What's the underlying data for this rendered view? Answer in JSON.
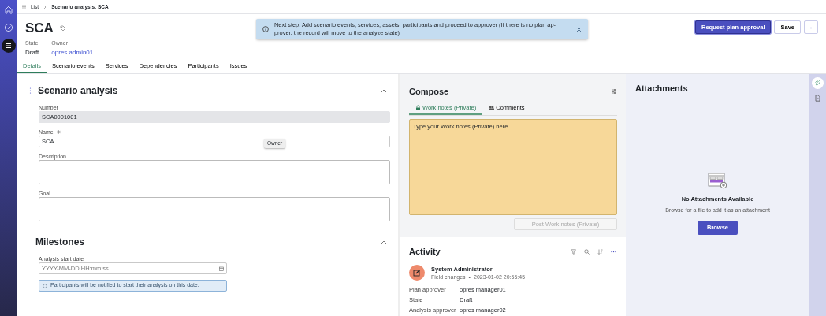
{
  "nav_rail": {
    "items": [
      {
        "kind": "home",
        "selected": false
      },
      {
        "kind": "check",
        "selected": false
      },
      {
        "kind": "list",
        "selected": true
      }
    ]
  },
  "breadcrumb": [
    "List",
    "Scenario analysis: SCA"
  ],
  "record": {
    "title": "SCA",
    "state_label": "State",
    "state": "Draft",
    "owner_label": "Owner",
    "owner": "opres admin01"
  },
  "notice": {
    "text": "Next step: Add scenario events, services, assets, participants and proceed to approver (If there is no plan ap-prover, the record will move to the analyze state)"
  },
  "actions": [
    {
      "kind": "primary",
      "label": "Request plan approval"
    },
    {
      "kind": "secondary",
      "label": "Save"
    },
    {
      "kind": "more"
    }
  ],
  "tabs": [
    {
      "label": "Details",
      "selected": true
    },
    {
      "label": "Scenario events",
      "selected": false
    },
    {
      "label": "Services",
      "selected": false
    },
    {
      "label": "Dependencies",
      "selected": false
    },
    {
      "label": "Participants",
      "selected": false
    },
    {
      "label": "Issues",
      "selected": false
    }
  ],
  "sections": [
    {
      "title": "Scenario analysis",
      "expanded": true,
      "fields": [
        {
          "kind": "text",
          "label": "Number",
          "value": "SCA0001001",
          "disabled": true,
          "required": false
        },
        {
          "kind": "text",
          "label": "Name",
          "value": "SCA",
          "disabled": false,
          "required": true
        },
        {
          "kind": "textarea",
          "label": "Description",
          "disabled": false,
          "required": false
        },
        {
          "kind": "textarea",
          "label": "Goal",
          "disabled": false,
          "required": false
        }
      ]
    },
    {
      "title": "Milestones",
      "expanded": true,
      "fields": [
        {
          "kind": "date",
          "label": "Analysis start date",
          "placeholder": "YYYY-MM-DD HH:mm:ss",
          "disabled": false,
          "required": false
        },
        {
          "kind": "info",
          "text": "Participants will be notified to start their analysis on this date."
        }
      ]
    }
  ],
  "tooltip": {
    "text": "Owner"
  },
  "compose": {
    "title": "Compose",
    "tabs": [
      {
        "kind": "lock",
        "label": "Work notes (Private)",
        "selected": true
      },
      {
        "kind": "people",
        "label": "Comments",
        "selected": false
      }
    ],
    "placeholder": "Type your Work notes (Private) here",
    "post_button": {
      "label": "Post Work notes (Private)",
      "disabled": true
    }
  },
  "activity": {
    "title": "Activity",
    "entries": [
      {
        "author": "System Administrator",
        "type": "Field changes",
        "separator": "•",
        "time": "2023-01-02 20:55:45",
        "changes": [
          {
            "field": "Plan approver",
            "value": "opres manager01"
          },
          {
            "field": "State",
            "value": "Draft"
          },
          {
            "field": "Analysis approver",
            "value": "opres manager02"
          }
        ]
      }
    ]
  },
  "attachments": {
    "title": "Attachments",
    "empty_title": "No Attachments Available",
    "empty_hint": "Browse for a file to add it as an attachment",
    "browse_button": "Browse"
  },
  "side_rail": {
    "items": [
      {
        "kind": "attachment",
        "selected": true
      },
      {
        "kind": "document",
        "selected": false
      }
    ]
  }
}
